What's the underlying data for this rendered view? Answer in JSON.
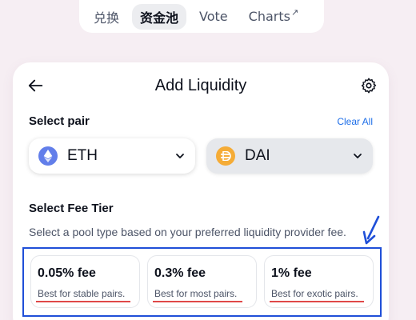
{
  "nav": {
    "items": [
      {
        "label": "兑换",
        "active": false
      },
      {
        "label": "资金池",
        "active": true
      },
      {
        "label": "Vote",
        "active": false
      },
      {
        "label": "Charts",
        "active": false,
        "external_glyph": "↗"
      }
    ]
  },
  "card": {
    "title": "Add Liquidity",
    "icons": {
      "back": "arrow-left-icon",
      "settings": "gear-icon"
    },
    "select_pair_label": "Select pair",
    "clear_all": "Clear All",
    "tokens": [
      {
        "symbol": "ETH",
        "logo": "eth-logo-icon",
        "color": "#627eea"
      },
      {
        "symbol": "DAI",
        "logo": "dai-logo-icon",
        "color": "#f5ac37"
      }
    ],
    "fee_tier_label": "Select Fee Tier",
    "fee_tier_desc": "Select a pool type based on your preferred liquidity provider fee.",
    "fee_tiers": [
      {
        "fee": "0.05% fee",
        "desc": "Best for stable pairs."
      },
      {
        "fee": "0.3% fee",
        "desc": "Best for most pairs."
      },
      {
        "fee": "1% fee",
        "desc": "Best for exotic pairs."
      }
    ]
  },
  "colors": {
    "background": "#f6eef3",
    "link": "#1d6ee8",
    "annotation_blue": "#1f4fd8",
    "annotation_red": "#e04848"
  }
}
